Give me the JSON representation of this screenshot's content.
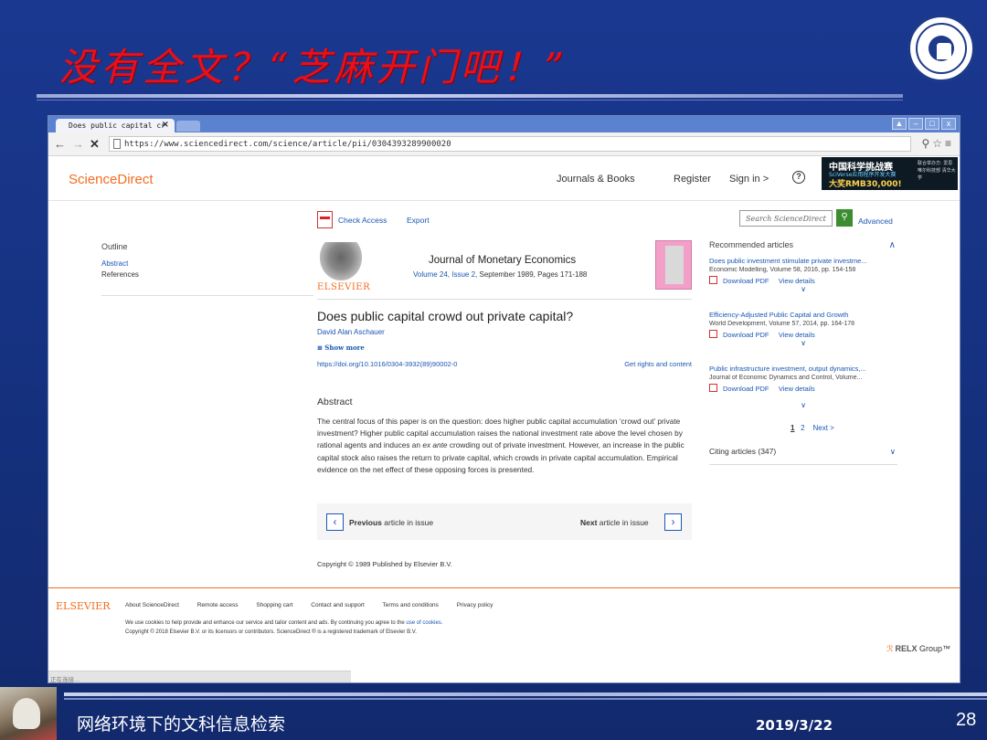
{
  "slide": {
    "title": "没有全文？“芝麻开门吧！”",
    "course": "网络环境下的文科信息检索",
    "date": "2019/3/22",
    "page_number": "28"
  },
  "browser": {
    "tab_title": "Does public capital cr",
    "url": "https://www.sciencedirect.com/science/article/pii/0304393289900020",
    "status": "正在连接..."
  },
  "header": {
    "logo": "ScienceDirect",
    "nav": [
      "Journals & Books",
      "Register",
      "Sign in >"
    ],
    "help": "?",
    "ad": {
      "line1": "中国科学挑战赛",
      "line2": "SciVerse应用程序开发大赛",
      "line3": "大奖RMB30,000!",
      "line4": "联合举办方: 爱思唯尔科技部 清华大学"
    }
  },
  "toolbar": {
    "check_access": "Check Access",
    "export": "Export",
    "search_placeholder": "Search ScienceDirect",
    "advanced": "Advanced"
  },
  "outline": {
    "heading": "Outline",
    "items": [
      "Abstract",
      "References"
    ]
  },
  "article": {
    "publisher_logo": "ELSEVIER",
    "journal": "Journal of Monetary Economics",
    "volume_issue": "Volume 24, Issue 2,",
    "pages": " September 1989, Pages 171-188",
    "title": "Does public capital crowd out private capital?",
    "author": "David Alan Aschauer",
    "show_more": "⊞ Show more",
    "doi": "https://doi.org/10.1016/0304-3932(89)90002-0",
    "rights": "Get rights and content",
    "abstract_heading": "Abstract",
    "abstract_part1": "The central focus of this paper is on the question: does higher public capital accumulation ‘crowd out’ private investment? Higher public capital accumulation raises the national investment rate above the level chosen by rational agents and induces an ",
    "abstract_italic": "ex ante",
    "abstract_part2": " crowding out of private investment. However, an increase in the public capital stock also raises the return to private capital, which crowds in private capital accumulation. Empirical evidence on the net effect of these opposing forces is presented.",
    "prev_bold": "Previous",
    "prev_rest": " article in issue",
    "next_bold": "Next",
    "next_rest": " article in issue",
    "copyright": "Copyright © 1989 Published by Elsevier B.V."
  },
  "recommended": {
    "heading": "Recommended articles",
    "items": [
      {
        "title": "Does public investment stimulate private investme...",
        "meta": "Economic Modelling, Volume 58, 2016, pp. 154-158",
        "pdf": "Download PDF",
        "details": "View details"
      },
      {
        "title": "Efficiency-Adjusted Public Capital and Growth",
        "meta": "World Development, Volume 57, 2014, pp. 164-178",
        "pdf": "Download PDF",
        "details": "View details"
      },
      {
        "title": "Public infrastructure investment, output dynamics,...",
        "meta": "Journal of Economic Dynamics and Control, Volume...",
        "pdf": "Download PDF",
        "details": "View details"
      }
    ],
    "page1": "1",
    "page2": "2",
    "next": "Next >",
    "citing": "Citing articles (347)"
  },
  "footer": {
    "logo": "ELSEVIER",
    "links": [
      "About ScienceDirect",
      "Remote access",
      "Shopping cart",
      "Contact and support",
      "Terms and conditions",
      "Privacy policy"
    ],
    "cookie_text": "We use cookies to help provide and enhance our service and tailor content and ads. By continuing you agree to the ",
    "cookie_link": "use of cookies.",
    "copyright": "Copyright © 2018 Elsevier B.V. or its licensors or contributors. ScienceDirect ® is a registered trademark of Elsevier B.V.",
    "relx_brand": "RELX",
    "relx_group": " Group™"
  }
}
